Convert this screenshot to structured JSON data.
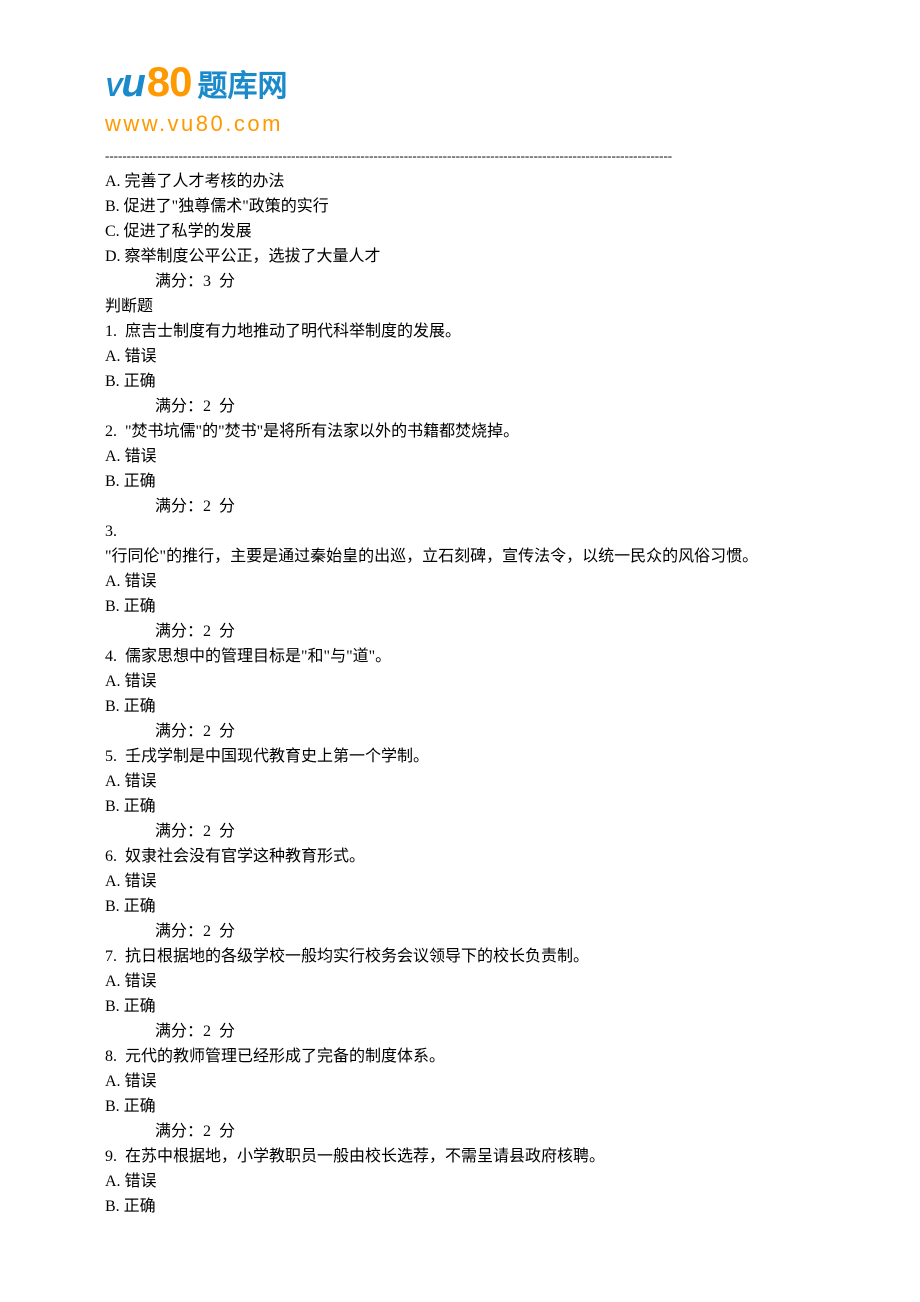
{
  "logo": {
    "vu_text": "Vu",
    "num_text": "80",
    "cn_text": "题库网",
    "url_text": "www.vu80.com"
  },
  "divider": "-----------------------------------------------------------------------------------------------------------------------------------",
  "lines": [
    {
      "text": "A. 完善了人才考核的办法",
      "class": ""
    },
    {
      "text": "B. 促进了\"独尊儒术\"政策的实行",
      "class": ""
    },
    {
      "text": "C. 促进了私学的发展",
      "class": ""
    },
    {
      "text": "D. 察举制度公平公正，选拔了大量人才",
      "class": ""
    },
    {
      "text": "满分：3  分",
      "class": "indented"
    },
    {
      "text": "判断题",
      "class": ""
    },
    {
      "text": "1.  庶吉士制度有力地推动了明代科举制度的发展。",
      "class": ""
    },
    {
      "text": "A. 错误",
      "class": ""
    },
    {
      "text": "B. 正确",
      "class": ""
    },
    {
      "text": "满分：2  分",
      "class": "indented"
    },
    {
      "text": "2.  \"焚书坑儒\"的\"焚书\"是将所有法家以外的书籍都焚烧掉。",
      "class": ""
    },
    {
      "text": "A. 错误",
      "class": ""
    },
    {
      "text": "B. 正确",
      "class": ""
    },
    {
      "text": "满分：2  分",
      "class": "indented"
    },
    {
      "text": "3. ",
      "class": ""
    },
    {
      "text": "\"行同伦\"的推行，主要是通过秦始皇的出巡，立石刻碑，宣传法令，以统一民众的风俗习惯。",
      "class": ""
    },
    {
      "text": "A. 错误",
      "class": ""
    },
    {
      "text": "B. 正确",
      "class": ""
    },
    {
      "text": "满分：2  分",
      "class": "indented"
    },
    {
      "text": "4.  儒家思想中的管理目标是\"和\"与\"道\"。",
      "class": ""
    },
    {
      "text": "A. 错误",
      "class": ""
    },
    {
      "text": "B. 正确",
      "class": ""
    },
    {
      "text": "满分：2  分",
      "class": "indented"
    },
    {
      "text": "5.  壬戌学制是中国现代教育史上第一个学制。",
      "class": ""
    },
    {
      "text": "A. 错误",
      "class": ""
    },
    {
      "text": "B. 正确",
      "class": ""
    },
    {
      "text": "满分：2  分",
      "class": "indented"
    },
    {
      "text": "6.  奴隶社会没有官学这种教育形式。",
      "class": ""
    },
    {
      "text": "A. 错误",
      "class": ""
    },
    {
      "text": "B. 正确",
      "class": ""
    },
    {
      "text": "满分：2  分",
      "class": "indented"
    },
    {
      "text": "7.  抗日根据地的各级学校一般均实行校务会议领导下的校长负责制。",
      "class": ""
    },
    {
      "text": "A. 错误",
      "class": ""
    },
    {
      "text": "B. 正确",
      "class": ""
    },
    {
      "text": "满分：2  分",
      "class": "indented"
    },
    {
      "text": "8.  元代的教师管理已经形成了完备的制度体系。",
      "class": ""
    },
    {
      "text": "A. 错误",
      "class": ""
    },
    {
      "text": "B. 正确",
      "class": ""
    },
    {
      "text": "满分：2  分",
      "class": "indented"
    },
    {
      "text": "9.  在苏中根据地，小学教职员一般由校长选荐，不需呈请县政府核聘。",
      "class": ""
    },
    {
      "text": "A. 错误",
      "class": ""
    },
    {
      "text": "B. 正确",
      "class": ""
    }
  ]
}
